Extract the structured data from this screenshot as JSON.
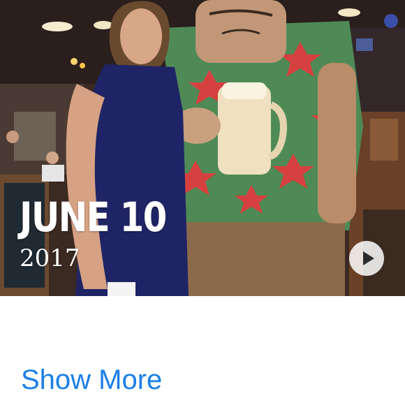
{
  "memory": {
    "title": "JUNE 10",
    "subtitle": "2017",
    "play_icon": "play-icon",
    "photo_description_icon": "photo"
  },
  "footer": {
    "show_more_label": "Show More"
  },
  "colors": {
    "link": "#1a7fe6",
    "title_text": "#ffffff",
    "background": "#ffffff"
  }
}
